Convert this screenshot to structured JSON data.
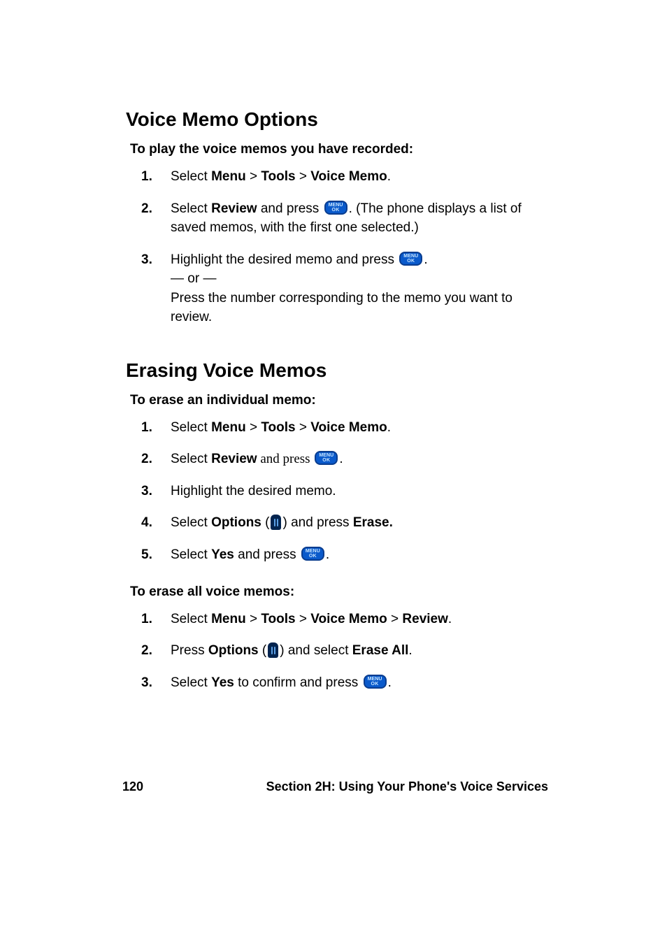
{
  "section1": {
    "heading": "Voice Memo Options",
    "subhead": "To play the voice memos you have recorded:",
    "steps": {
      "s1": {
        "prefix": "Select ",
        "b1": "Menu",
        "sep": " > ",
        "b2": "Tools",
        "b3": "Voice Memo",
        "suffix": "."
      },
      "s2": {
        "prefix": "Select ",
        "b1": "Review",
        "mid": " and press ",
        "btn": {
          "l1": "MENU",
          "l2": "OK"
        },
        "suffix": ". (The phone displays a list of saved memos, with the first one selected.)"
      },
      "s3": {
        "line1a": "Highlight the desired memo and press ",
        "btn": {
          "l1": "MENU",
          "l2": "OK"
        },
        "line1b": ".",
        "or": "— or —",
        "line2": "Press the number corresponding to the memo you want to review."
      }
    }
  },
  "section2": {
    "heading": "Erasing Voice Memos",
    "subhead1": "To erase an individual memo:",
    "steps1": {
      "s1": {
        "prefix": "Select ",
        "b1": "Menu",
        "sep": " > ",
        "b2": "Tools",
        "b3": "Voice Memo",
        "suffix": "."
      },
      "s2": {
        "prefix": "Select ",
        "b1": "Review",
        "mid": " and press ",
        "btn": {
          "l1": "MENU",
          "l2": "OK"
        },
        "suffix": "."
      },
      "s3": {
        "text": "Highlight the desired memo."
      },
      "s4": {
        "prefix": "Select ",
        "b1": "Options",
        "open": " (",
        "close": ") and press ",
        "b2": "Erase."
      },
      "s5": {
        "prefix": "Select ",
        "b1": "Yes",
        "mid": " and press ",
        "btn": {
          "l1": "MENU",
          "l2": "OK"
        },
        "suffix": "."
      }
    },
    "subhead2": "To erase all voice memos:",
    "steps2": {
      "s1": {
        "prefix": "Select ",
        "b1": "Menu",
        "sep": " > ",
        "b2": "Tools",
        "b3": "Voice Memo",
        "b4": "Review",
        "suffix": "."
      },
      "s2": {
        "prefix": "Press ",
        "b1": "Options",
        "open": " (",
        "close": ") and select ",
        "b2": "Erase All",
        "suffix": "."
      },
      "s3": {
        "prefix": "Select ",
        "b1": "Yes",
        "mid": " to confirm and press ",
        "btn": {
          "l1": "MENU",
          "l2": "OK"
        },
        "suffix": "."
      }
    }
  },
  "footer": {
    "page_number": "120",
    "section_label": "Section 2H: Using Your Phone's Voice Services"
  }
}
